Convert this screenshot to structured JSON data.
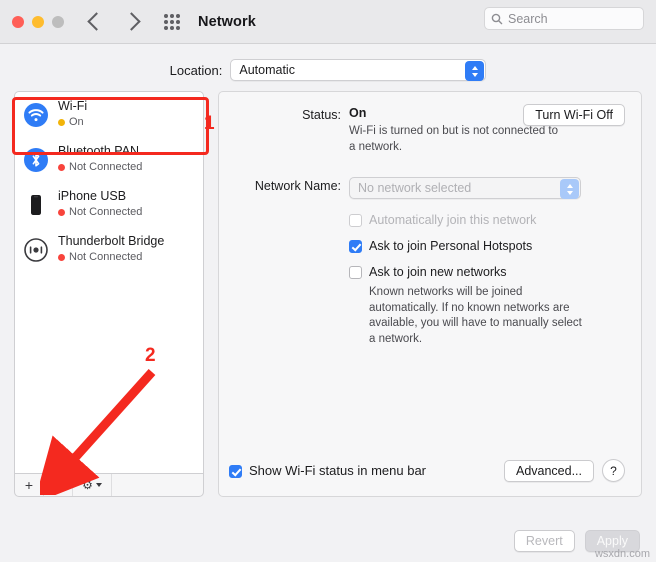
{
  "window": {
    "title": "Network",
    "search_placeholder": "Search"
  },
  "location": {
    "label": "Location:",
    "value": "Automatic"
  },
  "services": [
    {
      "name": "Wi-Fi",
      "status": "On",
      "status_color": "green",
      "icon": "wifi-icon"
    },
    {
      "name": "Bluetooth PAN",
      "status": "Not Connected",
      "status_color": "red",
      "icon": "bluetooth-icon"
    },
    {
      "name": "iPhone USB",
      "status": "Not Connected",
      "status_color": "red",
      "icon": "iphone-icon"
    },
    {
      "name": "Thunderbolt Bridge",
      "status": "Not Connected",
      "status_color": "red",
      "icon": "thunderbolt-bridge-icon"
    }
  ],
  "list_toolbar": {
    "add": "+",
    "remove": "−",
    "action": "⚙"
  },
  "panel": {
    "status_label": "Status:",
    "status_value": "On",
    "status_detail": "Wi-Fi is turned on but is not connected to a network.",
    "turn_off_button": "Turn Wi-Fi Off",
    "network_name_label": "Network Name:",
    "network_name_value": "No network selected",
    "auto_join_label": "Automatically join this network",
    "ask_hotspots_label": "Ask to join Personal Hotspots",
    "ask_new_networks_label": "Ask to join new networks",
    "known_networks_help": "Known networks will be joined automatically. If no known networks are available, you will have to manually select a network.",
    "show_status_label": "Show Wi-Fi status in menu bar",
    "advanced_button": "Advanced...",
    "help_button": "?"
  },
  "footer": {
    "revert_button": "Revert",
    "apply_button": "Apply"
  },
  "annotations": {
    "one": "1",
    "two": "2",
    "accent_color": "#f4291f"
  },
  "watermark": "wsxdn.com"
}
